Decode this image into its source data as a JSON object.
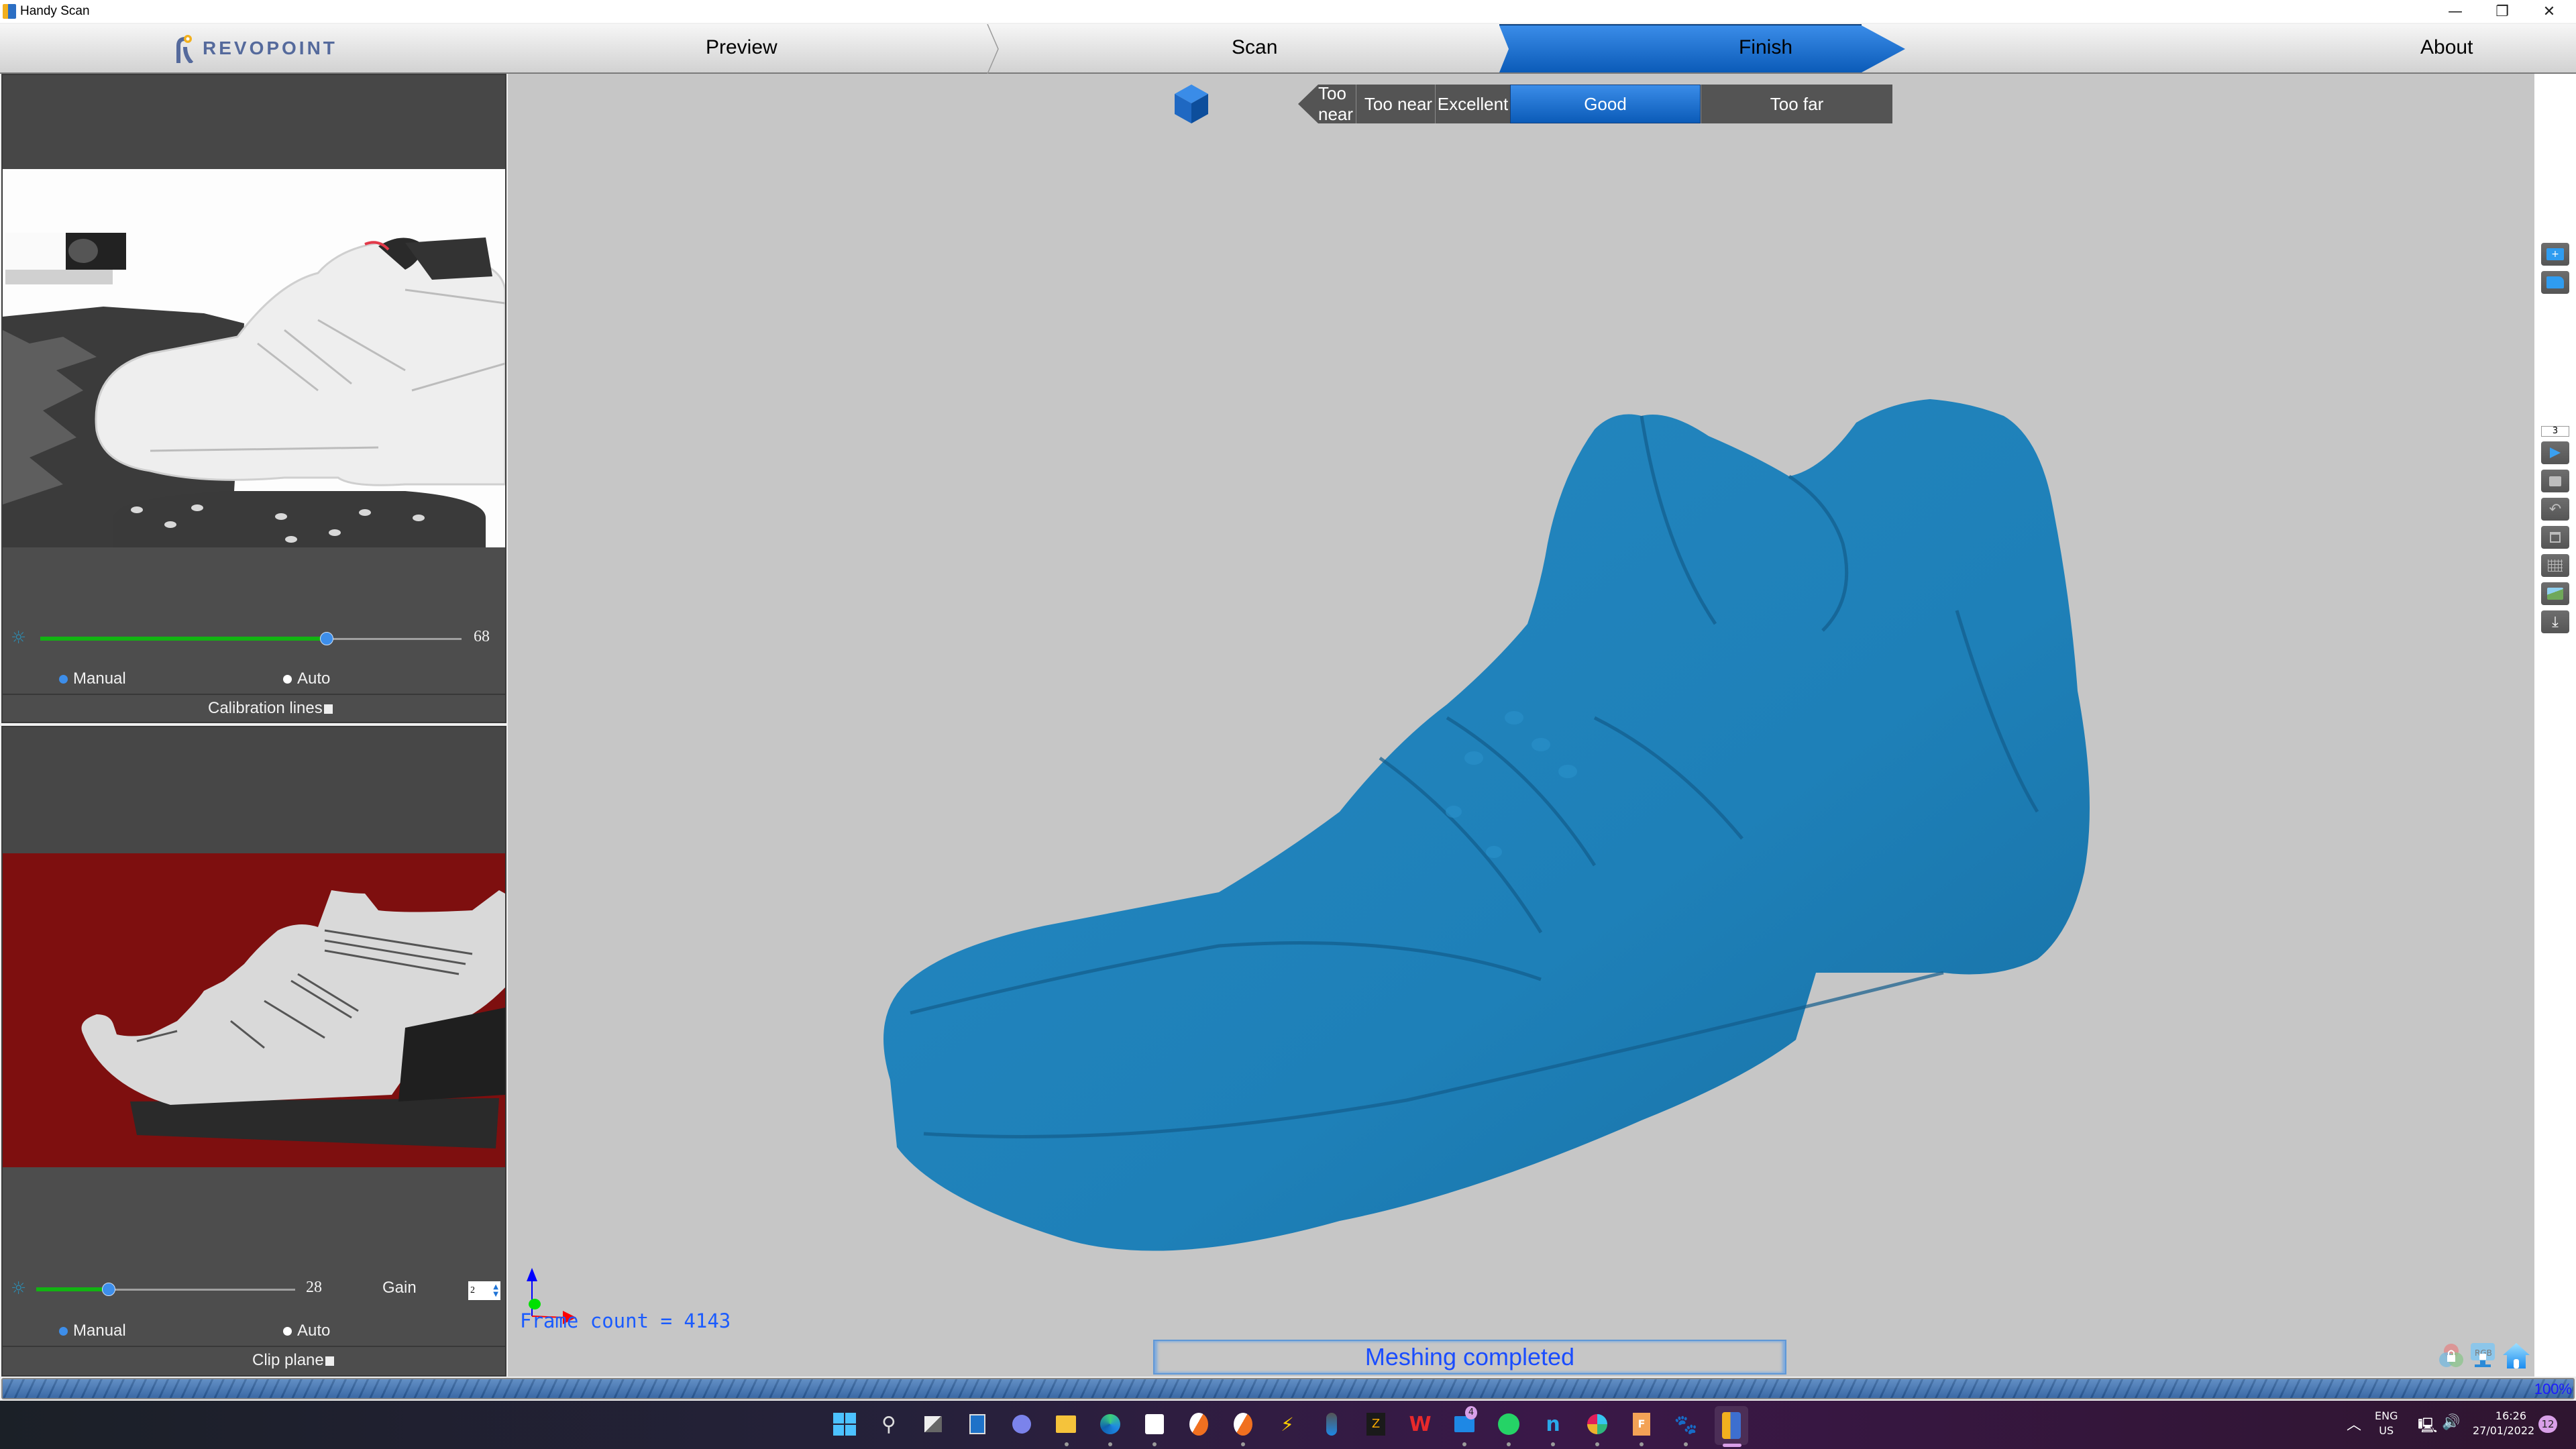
{
  "window": {
    "title": "Handy Scan",
    "controls": {
      "minimize": "—",
      "restore": "❐",
      "close": "✕"
    }
  },
  "navbar": {
    "logo_text": "REVOPOINT",
    "steps": [
      {
        "label": "Preview",
        "active": false
      },
      {
        "label": "Scan",
        "active": false
      },
      {
        "label": "Finish",
        "active": true
      }
    ],
    "about_label": "About",
    "accent_color": "#1f74d6"
  },
  "left_panel": {
    "rgb_camera": {
      "exposure_value": "68",
      "exposure_fraction": 0.68,
      "mode_options": [
        "Manual",
        "Auto"
      ],
      "selected_mode": "Manual",
      "checkbox_label": "Calibration lines",
      "checkbox_checked": false
    },
    "depth_camera": {
      "exposure_value": "28",
      "exposure_fraction": 0.28,
      "gain_label": "Gain",
      "gain_value": "2",
      "mode_options": [
        "Manual",
        "Auto"
      ],
      "selected_mode": "Manual",
      "checkbox_label": "Clip plane",
      "checkbox_checked": false,
      "background_color": "#7e0f0f"
    }
  },
  "viewport": {
    "distance_indicator": {
      "segments": [
        "Too near",
        "Excellent",
        "Good",
        "Too far"
      ],
      "active": "Good"
    },
    "frame_count_text": "Frame count = 4143",
    "status_text": "Meshing completed",
    "model_color": "#1e80b8",
    "background_color": "#c6c6c6"
  },
  "right_toolbar": {
    "counter_value": "3",
    "buttons": [
      "new-project",
      "open-project",
      "play",
      "stop",
      "undo",
      "delete",
      "mesh",
      "add-texture",
      "export"
    ]
  },
  "viewport_corner_icons": [
    "color-lock",
    "rgb-lock",
    "home"
  ],
  "progress": {
    "value_percent": 100,
    "label": "100%"
  },
  "taskbar": {
    "apps": [
      "start",
      "search",
      "task-view",
      "widgets",
      "teams-chat",
      "file-explorer",
      "edge",
      "store",
      "app-1",
      "app-2",
      "network-app",
      "app-3",
      "app-4",
      "wps",
      "mail",
      "whatsapp",
      "app-5",
      "slack",
      "fusion-360",
      "gimp",
      "handy-scan"
    ],
    "mail_badge": "4",
    "language_line1": "ENG",
    "language_line2": "US",
    "time": "16:26",
    "date": "27/01/2022",
    "notification_count": "12"
  }
}
